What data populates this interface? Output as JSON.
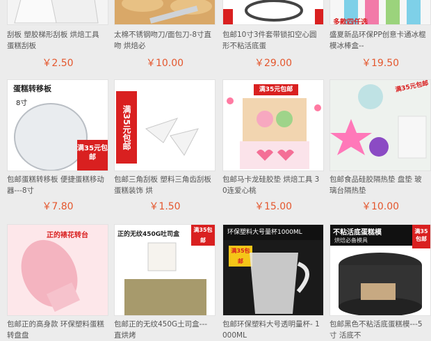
{
  "products": [
    {
      "title": "刮板 塑胶梯形刮板 烘焙工具 蛋糕刮板",
      "price": "￥2.50"
    },
    {
      "title": "太棉不锈钢吻刀/面包刀-8寸直 吻 烘焙必",
      "price": "￥10.00"
    },
    {
      "title": "包邮10寸3件套带锁扣空心圆 形不粘活底蛋",
      "price": "￥29.00"
    },
    {
      "title": "盛夏新品环保PP创意卡通冰棍 模冰棒盒--",
      "price": "￥19.50",
      "img_label": "多款四任选"
    },
    {
      "title": "包邮蛋糕转移板 便捷蛋糕移动 器---8寸",
      "price": "￥7.80",
      "img_label": "蛋糕转移板",
      "img_sub": "8寸",
      "promo": "满35元包邮"
    },
    {
      "title": "包邮三角刮板 塑料三角齿刮板 蛋糕装饰 烘",
      "price": "￥1.50",
      "promo": "满35元包邮"
    },
    {
      "title": "包邮马卡龙硅胶垫 烘焙工具 30连爱心桃",
      "price": "￥15.00",
      "promo": "满35元包邮"
    },
    {
      "title": "包邮食品硅胶隔热垫 盘垫 玻 璃台隔热垫",
      "price": "￥10.00",
      "promo": "满35元包邮"
    },
    {
      "title": "包邮正的高身款 环保塑料蛋糕 转盘盘",
      "price": "",
      "img_label": "正的裱花转台"
    },
    {
      "title": "包邮正的无纹450G土司盒--- 直烘烤",
      "price": "",
      "img_label": "正的无纹450G吐司盒",
      "promo": "满35包邮"
    },
    {
      "title": "包邮环保塑料大号透明量杯- 1000ML",
      "price": "",
      "img_label": "环保塑料大号量杯1000ML",
      "promo": "满35包邮"
    },
    {
      "title": "包邮黑色不粘活底蛋糕模---5 寸 活底不",
      "price": "",
      "img_label": "不粘活底蛋糕模",
      "img_sub": "烘焙必备模具",
      "promo": "满35包邮"
    }
  ]
}
